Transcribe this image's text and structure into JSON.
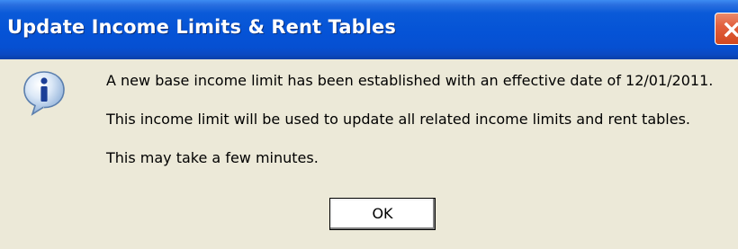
{
  "dialog": {
    "title": "Update Income Limits & Rent Tables",
    "icon": "info-icon",
    "messages": [
      "A new base income limit has been established with an effective date of 12/01/2011.",
      "This income limit will be used to update all related income limits and rent tables.",
      "This may take a few minutes."
    ],
    "ok_label": "OK",
    "close_icon": "close-icon"
  },
  "colors": {
    "titlebar": "#0553d6",
    "close_button": "#e2603e",
    "body_background": "#ece9d8"
  }
}
